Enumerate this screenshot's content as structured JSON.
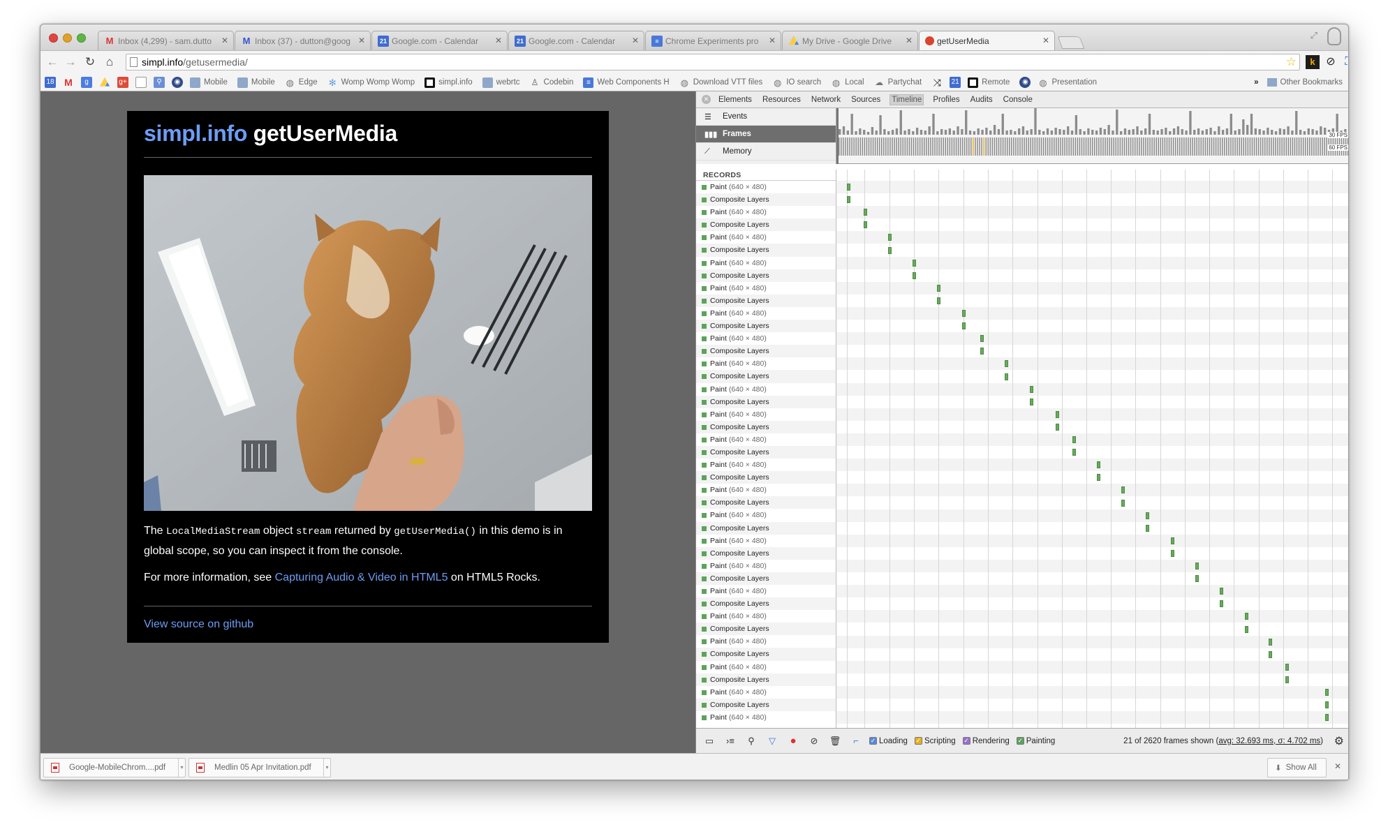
{
  "browser": {
    "tabs": [
      {
        "title": "Inbox (4,299) - sam.dutto",
        "icon": "gmail-icon"
      },
      {
        "title": "Inbox (37) - dutton@goog",
        "icon": "gmail-icon"
      },
      {
        "title": "Google.com - Calendar",
        "icon": "calendar-icon"
      },
      {
        "title": "Google.com - Calendar",
        "icon": "calendar-icon"
      },
      {
        "title": "Chrome Experiments pro",
        "icon": "docs-icon"
      },
      {
        "title": "My Drive - Google Drive",
        "icon": "drive-icon"
      },
      {
        "title": "getUserMedia",
        "icon": "html5-icon"
      }
    ],
    "url_host": "simpl.info",
    "url_path": "/getusermedia/",
    "bookmarks": [
      {
        "label": "Mobile",
        "icon": "folder-icon"
      },
      {
        "label": "Mobile",
        "icon": "folder-icon"
      },
      {
        "label": "Edge",
        "icon": "globe-icon"
      },
      {
        "label": "Womp Womp Womp",
        "icon": "gear-icon"
      },
      {
        "label": "simpl.info",
        "icon": "square-icon"
      },
      {
        "label": "webrtc",
        "icon": "folder-icon"
      },
      {
        "label": "Codebin",
        "icon": "person-icon"
      },
      {
        "label": "Web Components H",
        "icon": "docs-icon"
      },
      {
        "label": "Download VTT files",
        "icon": "globe-icon"
      },
      {
        "label": "IO search",
        "icon": "globe-icon"
      },
      {
        "label": "Local",
        "icon": "globe-icon"
      },
      {
        "label": "Partychat",
        "icon": "chat-icon"
      },
      {
        "label": "Remote",
        "icon": "square-icon"
      },
      {
        "label": "Presentation",
        "icon": "globe-icon"
      }
    ],
    "other_bookmarks": "Other Bookmarks",
    "chevron": "»"
  },
  "page": {
    "title_blue": "simpl.info",
    "title_white": "getUserMedia",
    "p1_a": "The ",
    "p1_code1": "LocalMediaStream",
    "p1_b": " object ",
    "p1_code2": "stream",
    "p1_c": " returned by ",
    "p1_code3": "getUserMedia()",
    "p1_d": " in this demo is in global scope, so you can inspect it from the console.",
    "p2_a": "For more information, see ",
    "p2_link": "Capturing Audio & Video in HTML5",
    "p2_b": " on HTML5 Rocks.",
    "source_link": "View source on github"
  },
  "devtools": {
    "tabs": [
      "Elements",
      "Resources",
      "Network",
      "Sources",
      "Timeline",
      "Profiles",
      "Audits",
      "Console"
    ],
    "selected_tab": "Timeline",
    "overview_items": [
      "Events",
      "Frames",
      "Memory"
    ],
    "fps_labels": [
      "30 FPS",
      "60 FPS"
    ],
    "records_header": "RECORDS",
    "record_paint": "Paint",
    "record_paint_dim": "(640 × 480)",
    "record_composite": "Composite Layers",
    "record_count": 43,
    "filters": [
      "Loading",
      "Scripting",
      "Rendering",
      "Painting"
    ],
    "filter_colors": [
      "#5b8ad8",
      "#e6b020",
      "#9a6fd0",
      "#5ca35c"
    ],
    "status_prefix": "21 of 2620 frames shown (",
    "status_avg": "avg: 32.693 ms, σ: 4.702 ms",
    "status_suffix": ")"
  },
  "downloads": {
    "items": [
      "Google-MobileChrom....pdf",
      "Medlin 05 Apr Invitation.pdf"
    ],
    "show_all": "Show All"
  }
}
